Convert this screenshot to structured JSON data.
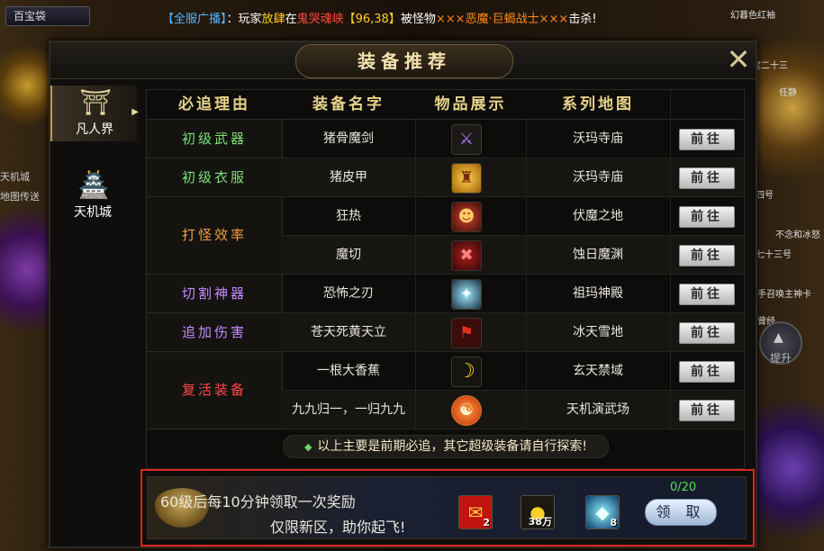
{
  "topbar": {
    "baibao_label": "百宝袋",
    "broadcast": {
      "tag": "【全服广播】",
      "colon": "：",
      "p1": "玩家",
      "player": "放肆",
      "p2": "在",
      "place": "鬼哭魂峡",
      "coords": "【96,38】",
      "p3": "被怪物",
      "monster": "×××恶魔·巨蝎战士×××",
      "p4": "击杀!"
    }
  },
  "left_notes": [
    "天机城",
    "地图传送"
  ],
  "right_notes": [
    "幻暮色红袖",
    "宝二十三",
    "任静",
    "十四号",
    "不念和冰怒",
    "七十三号",
    "高手召唤主神卡",
    "曾经"
  ],
  "tisheng_label": "提升",
  "panel": {
    "title": "装备推荐",
    "close_icon": "close-icon"
  },
  "sidebar": [
    {
      "label": "凡人界",
      "icon": "temple-icon",
      "active": true
    },
    {
      "label": "天机城",
      "icon": "castle-icon",
      "active": false
    }
  ],
  "table": {
    "headers": [
      "必追理由",
      "装备名字",
      "物品展示",
      "系列地图"
    ],
    "groups": [
      {
        "reason": "初级武器",
        "color": "#7ee07a",
        "rows": 1
      },
      {
        "reason": "初级衣服",
        "color": "#7ee07a",
        "rows": 1
      },
      {
        "reason": "打怪效率",
        "color": "#f0a040",
        "rows": 2
      },
      {
        "reason": "切割神器",
        "color": "#c48cff",
        "rows": 1
      },
      {
        "reason": "追加伤害",
        "color": "#c48cff",
        "rows": 1
      },
      {
        "reason": "复活装备",
        "color": "#ff4848",
        "rows": 2
      }
    ],
    "rows": [
      {
        "name": "猪骨魔剑",
        "icon": "sword-icon",
        "map": "沃玛寺庙",
        "go": "前往"
      },
      {
        "name": "猪皮甲",
        "icon": "armor-icon",
        "map": "沃玛寺庙",
        "go": "前往"
      },
      {
        "name": "狂热",
        "icon": "rage-icon",
        "map": "伏魔之地",
        "go": "前往"
      },
      {
        "name": "魔切",
        "icon": "demon-cut-icon",
        "map": "蚀日魔渊",
        "go": "前往"
      },
      {
        "name": "恐怖之刃",
        "icon": "blade-icon",
        "map": "祖玛神殿",
        "go": "前往"
      },
      {
        "name": "苍天死黄天立",
        "icon": "flag-icon",
        "map": "冰天雪地",
        "go": "前往"
      },
      {
        "name": "一根大香蕉",
        "icon": "banana-icon",
        "map": "玄天禁域",
        "go": "前往"
      },
      {
        "name": "九九归一，一归九九",
        "icon": "orb-icon",
        "map": "天机演武场",
        "go": "前往"
      }
    ]
  },
  "note": "以上主要是前期必追，其它超级装备请自行探索!",
  "reward": {
    "line1": "60级后每10分钟领取一次奖励",
    "line2": "仅限新区，助你起飞!",
    "progress": "0/20",
    "claim_label": "领 取",
    "items": [
      {
        "icon": "red-envelope-icon",
        "qty": "2"
      },
      {
        "icon": "gold-pile-icon",
        "qty": "38万"
      },
      {
        "icon": "crystal-icon",
        "qty": "8"
      }
    ]
  }
}
